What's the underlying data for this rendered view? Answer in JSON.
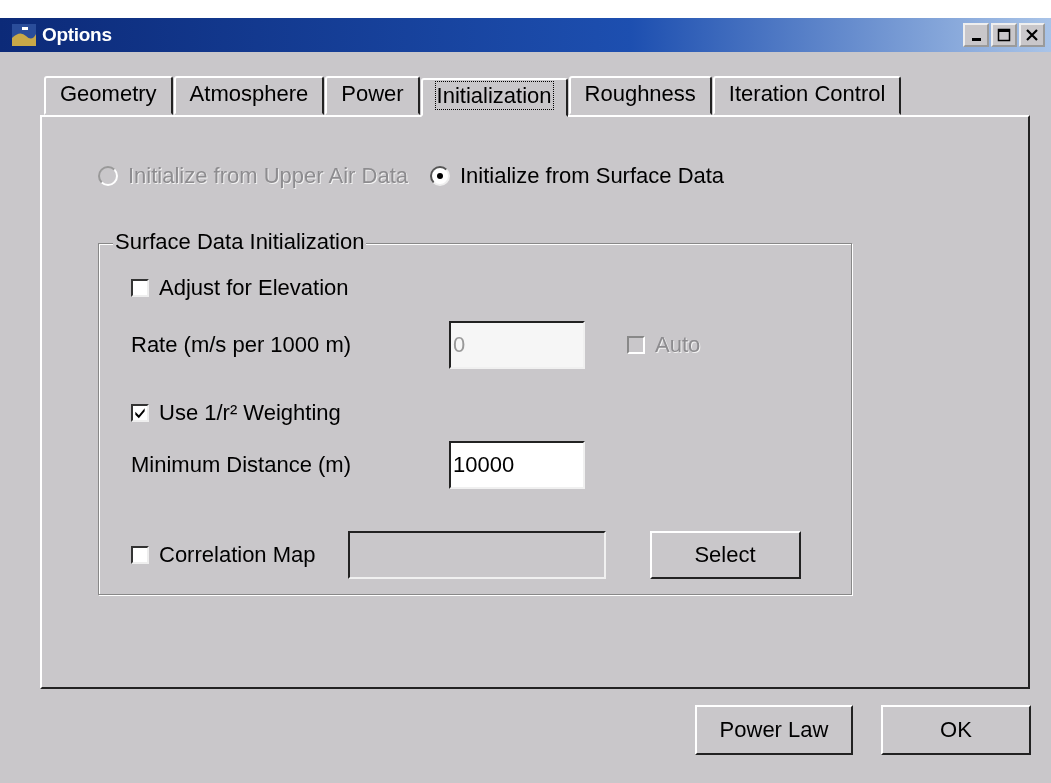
{
  "window": {
    "title": "Options"
  },
  "tabs": [
    {
      "label": "Geometry",
      "selected": false
    },
    {
      "label": "Atmosphere",
      "selected": false
    },
    {
      "label": "Power",
      "selected": false
    },
    {
      "label": "Initialization",
      "selected": true
    },
    {
      "label": "Roughness",
      "selected": false
    },
    {
      "label": "Iteration Control",
      "selected": false
    }
  ],
  "init_source": [
    {
      "label": "Initialize from Upper Air Data",
      "selected": false,
      "disabled": true
    },
    {
      "label": "Initialize from Surface Data",
      "selected": true,
      "disabled": false
    }
  ],
  "surface_group": {
    "title": "Surface Data Initialization",
    "adjust_elevation": {
      "label": "Adjust for Elevation",
      "checked": false,
      "disabled": false
    },
    "rate": {
      "label": "Rate (m/s per 1000 m)",
      "value": "0",
      "disabled": true
    },
    "auto": {
      "label": "Auto",
      "checked": false,
      "disabled": true
    },
    "weighting": {
      "label": "Use 1/r² Weighting",
      "checked": true,
      "disabled": false
    },
    "min_distance": {
      "label": "Minimum Distance (m)",
      "value": "10000",
      "disabled": false
    },
    "correlation_map": {
      "label": "Correlation Map",
      "checked": false,
      "disabled": false
    },
    "map_file": {
      "disabled": true
    },
    "select_button": {
      "label": "Select"
    }
  },
  "buttons": [
    {
      "label": "Power Law"
    },
    {
      "label": "OK"
    }
  ]
}
